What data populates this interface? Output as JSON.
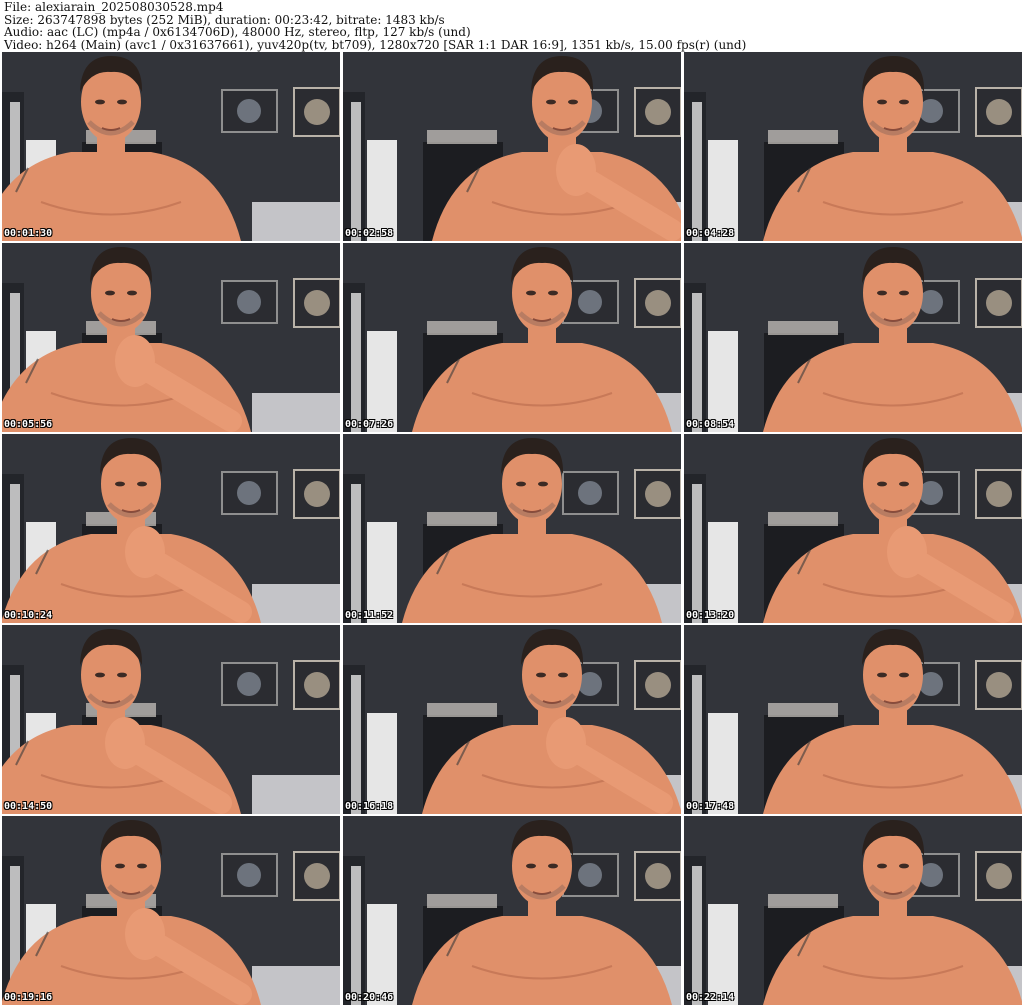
{
  "header": {
    "file_line": "File: alexiarain_202508030528.mp4",
    "size_line": "Size: 263747898 bytes (252 MiB), duration: 00:23:42, bitrate: 1483 kb/s",
    "audio_line": "Audio: aac (LC) (mp4a / 0x6134706D), 48000 Hz, stereo, fltp, 127 kb/s (und)",
    "video_line": "Video: h264 (Main) (avc1 / 0x31637661), yuv420p(tv, bt709), 1280x720 [SAR 1:1 DAR 16:9], 1351 kb/s, 15.00 fps(r) (und)"
  },
  "thumbnails": [
    {
      "timestamp": "00:01:30"
    },
    {
      "timestamp": "00:02:58"
    },
    {
      "timestamp": "00:04:28"
    },
    {
      "timestamp": "00:05:56"
    },
    {
      "timestamp": "00:07:26"
    },
    {
      "timestamp": "00:08:54"
    },
    {
      "timestamp": "00:10:24"
    },
    {
      "timestamp": "00:11:52"
    },
    {
      "timestamp": "00:13:20"
    },
    {
      "timestamp": "00:14:50"
    },
    {
      "timestamp": "00:16:18"
    },
    {
      "timestamp": "00:17:48"
    },
    {
      "timestamp": "00:19:16"
    },
    {
      "timestamp": "00:20:46"
    },
    {
      "timestamp": "00:22:14"
    }
  ],
  "colors": {
    "wall": "#2e3036",
    "skin": "#e0906a",
    "hair": "#2a211d",
    "timestamp_text": "#ffffff"
  }
}
